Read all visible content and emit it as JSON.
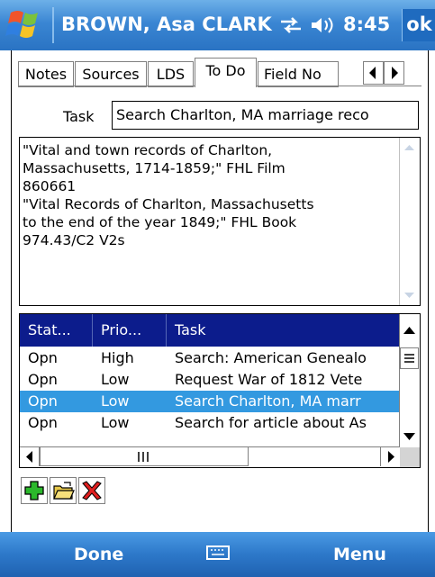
{
  "titlebar": {
    "title": "BROWN, Asa CLARK",
    "time": "8:45",
    "ok_label": "ok",
    "start_icon": "windows-flag-icon",
    "sync_icon": "connectivity-arrows-icon",
    "volume_icon": "speaker-icon",
    "color": "#3a86d3"
  },
  "tabs": {
    "items": [
      {
        "label": "Notes"
      },
      {
        "label": "Sources"
      },
      {
        "label": "LDS"
      },
      {
        "label": "To Do",
        "active": true
      },
      {
        "label": "Field No"
      }
    ],
    "scroll_left_icon": "arrow-left-icon",
    "scroll_right_icon": "arrow-right-icon"
  },
  "task": {
    "label": "Task",
    "value": "Search Charlton, MA marriage reco"
  },
  "notes": {
    "text": "\"Vital and town records of Charlton,\nMassachusetts, 1714-1859;\" FHL Film\n860661\n\"Vital Records of Charlton, Massachusetts\nto the end of the year 1849;\" FHL Book\n974.43/C2 V2s"
  },
  "grid": {
    "columns": [
      "Stat...",
      "Prio...",
      "Task"
    ],
    "rows": [
      {
        "status": "Opn",
        "priority": "High",
        "task": "Search: American Genealo"
      },
      {
        "status": "Opn",
        "priority": "Low",
        "task": "Request War of 1812 Vete"
      },
      {
        "status": "Opn",
        "priority": "Low",
        "task": "Search Charlton, MA marr",
        "selected": true
      },
      {
        "status": "Opn",
        "priority": "Low",
        "task": "Search for article about As"
      }
    ],
    "header_color": "#0c1c8c",
    "selected_color": "#3399e0"
  },
  "toolbar": {
    "add_icon": "add-plus-icon",
    "open_icon": "open-folder-icon",
    "delete_icon": "delete-x-icon"
  },
  "menubar": {
    "left": "Done",
    "right": "Menu",
    "center_icon": "keyboard-icon"
  }
}
